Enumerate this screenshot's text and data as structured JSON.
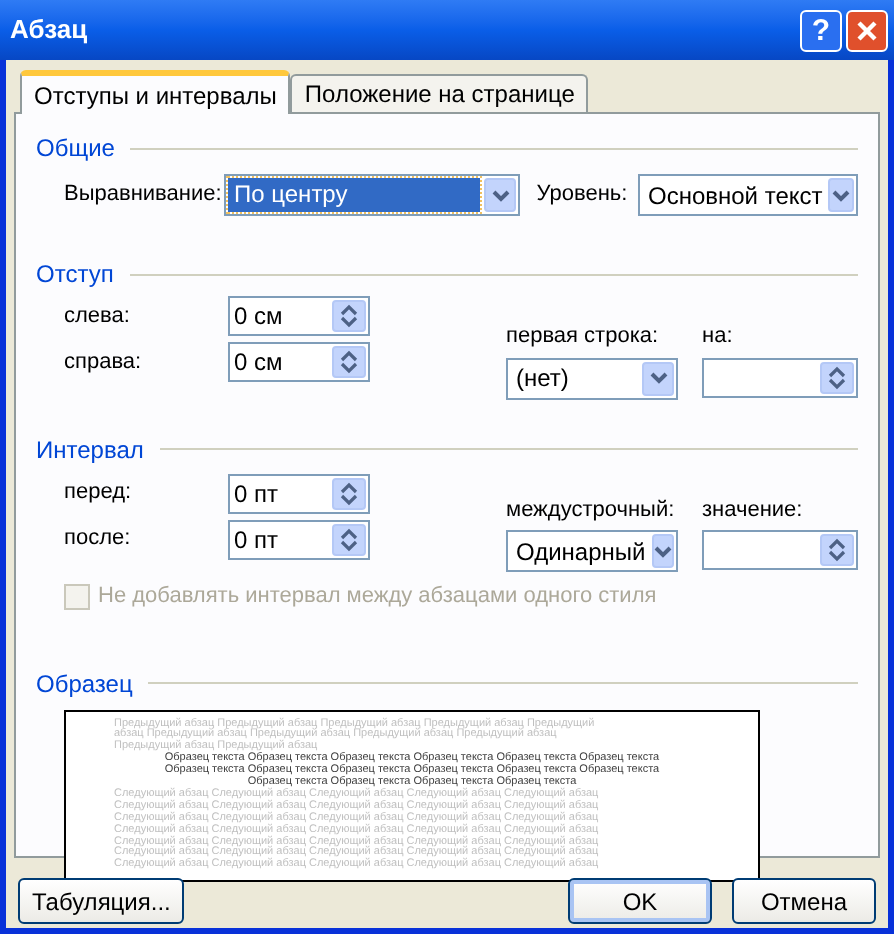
{
  "window": {
    "title": "Абзац",
    "help_button": "?"
  },
  "tabs": [
    {
      "label": "Отступы и интервалы",
      "selected": true
    },
    {
      "label": "Положение на странице",
      "selected": false
    }
  ],
  "general": {
    "title": "Общие",
    "alignment": {
      "label": "Выравнивание:",
      "value": "По центру",
      "focused": true
    },
    "outline_level": {
      "label": "Уровень:",
      "value": "Основной текст",
      "focused": false
    }
  },
  "indent": {
    "title": "Отступ",
    "left": {
      "label": "слева:",
      "value": "0 см"
    },
    "right": {
      "label": "справа:",
      "value": "0 см"
    },
    "first_line": {
      "label": "первая строка:",
      "value": "(нет)",
      "focused": false
    },
    "by": {
      "label": "на:"
    }
  },
  "spacing": {
    "title": "Интервал",
    "before": {
      "label": "перед:",
      "value": "0 пт"
    },
    "after": {
      "label": "после:",
      "value": "0 пт"
    },
    "line_spacing": {
      "label": "междустрочный:",
      "value": "Одинарный",
      "focused": false
    },
    "at": {
      "label": "значение:"
    },
    "no_space_checkbox": {
      "label": "Не добавлять интервал между абзацами одного стиля",
      "checked": false,
      "disabled": true
    }
  },
  "preview": {
    "title": "Образец",
    "previous_lines": [
      "Предыдущий абзац Предыдущий абзац Предыдущий абзац Предыдущий абзац Предыдущий",
      "абзац Предыдущий абзац Предыдущий абзац Предыдущий абзац Предыдущий абзац",
      "Предыдущий абзац Предыдущий абзац"
    ],
    "sample_lines": [
      "Образец текста Образец текста Образец текста Образец текста Образец текста Образец текста",
      "Образец текста Образец текста Образец текста Образец текста Образец текста Образец текста",
      "Образец текста Образец текста Образец текста Образец текста"
    ],
    "next_lines": [
      "Следующий абзац Следующий абзац Следующий абзац Следующий абзац Следующий абзац",
      "Следующий абзац Следующий абзац Следующий абзац Следующий абзац Следующий абзац",
      "Следующий абзац Следующий абзац Следующий абзац Следующий абзац Следующий абзац",
      "Следующий абзац Следующий абзац Следующий абзац Следующий абзац Следующий абзац",
      "Следующий абзац Следующий абзац Следующий абзац Следующий абзац Следующий абзац",
      "Следующий абзац Следующий абзац Следующий абзац Следующий абзац Следующий абзац",
      "Следующий абзац Следующий абзац Следующий абзац Следующий абзац Следующий абзац"
    ]
  },
  "buttons": [
    {
      "label": "Табуляция...",
      "default": false
    },
    {
      "label": "OK",
      "default": true
    },
    {
      "label": "Отмена",
      "default": false
    }
  ]
}
